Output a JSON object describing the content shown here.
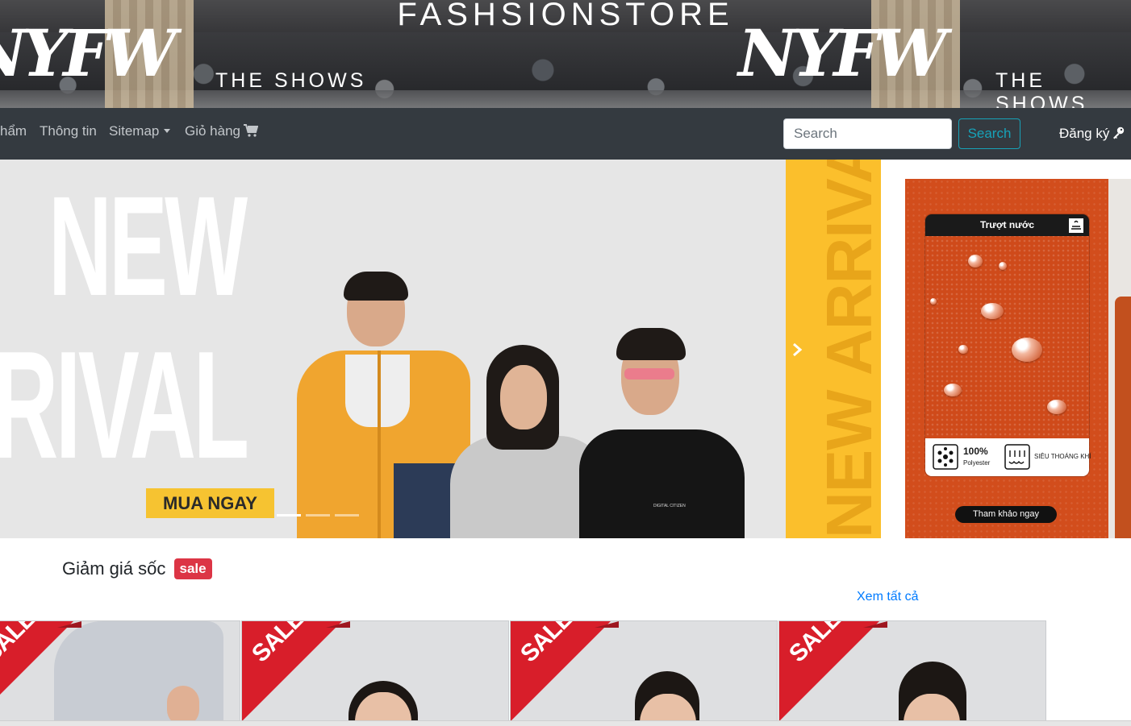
{
  "header": {
    "store_title": "FASHSIONSTORE",
    "logo_mark": "NYFW",
    "logo_subtitle": "THE SHOWS"
  },
  "navbar": {
    "items": [
      {
        "label": "hẩm"
      },
      {
        "label": "Thông tin"
      },
      {
        "label": "Sitemap"
      },
      {
        "label": "Giỏ hàng"
      }
    ],
    "search_placeholder": "Search",
    "search_button": "Search",
    "register_label": "Đăng ký",
    "icons": {
      "cart": "shopping-cart-icon",
      "key": "key-icon",
      "dropdown": "caret-down-icon"
    }
  },
  "hero": {
    "headline_line1": "NEW",
    "headline_line2": "RIVAL",
    "cta": "MUA NGAY",
    "side_strip_text": "NEW ARRIVAL",
    "tshirt_print": "DIGITAL CITIZEN",
    "slides_total": 3,
    "active_slide": 1,
    "colors": {
      "accent_yellow": "#fbbf2c",
      "button_yellow": "#f6c331"
    }
  },
  "promo": {
    "header": "Trượt nước",
    "material_percent": "100%",
    "material_name": "Polyester",
    "feature": "SIÊU THOÁNG KHÍ",
    "cta": "Tham khảo ngay",
    "color": "#d24d1c"
  },
  "sale_section": {
    "title": "Giảm giá sốc",
    "badge": "sale",
    "view_all": "Xem tất cả",
    "products": [
      {
        "ribbon": "SALE"
      },
      {
        "ribbon": "SALE"
      },
      {
        "ribbon": "SALE"
      },
      {
        "ribbon": "SALE"
      }
    ],
    "colors": {
      "badge_red": "#dc3545",
      "ribbon_red": "#d81e2a",
      "link_blue": "#007bff"
    }
  }
}
